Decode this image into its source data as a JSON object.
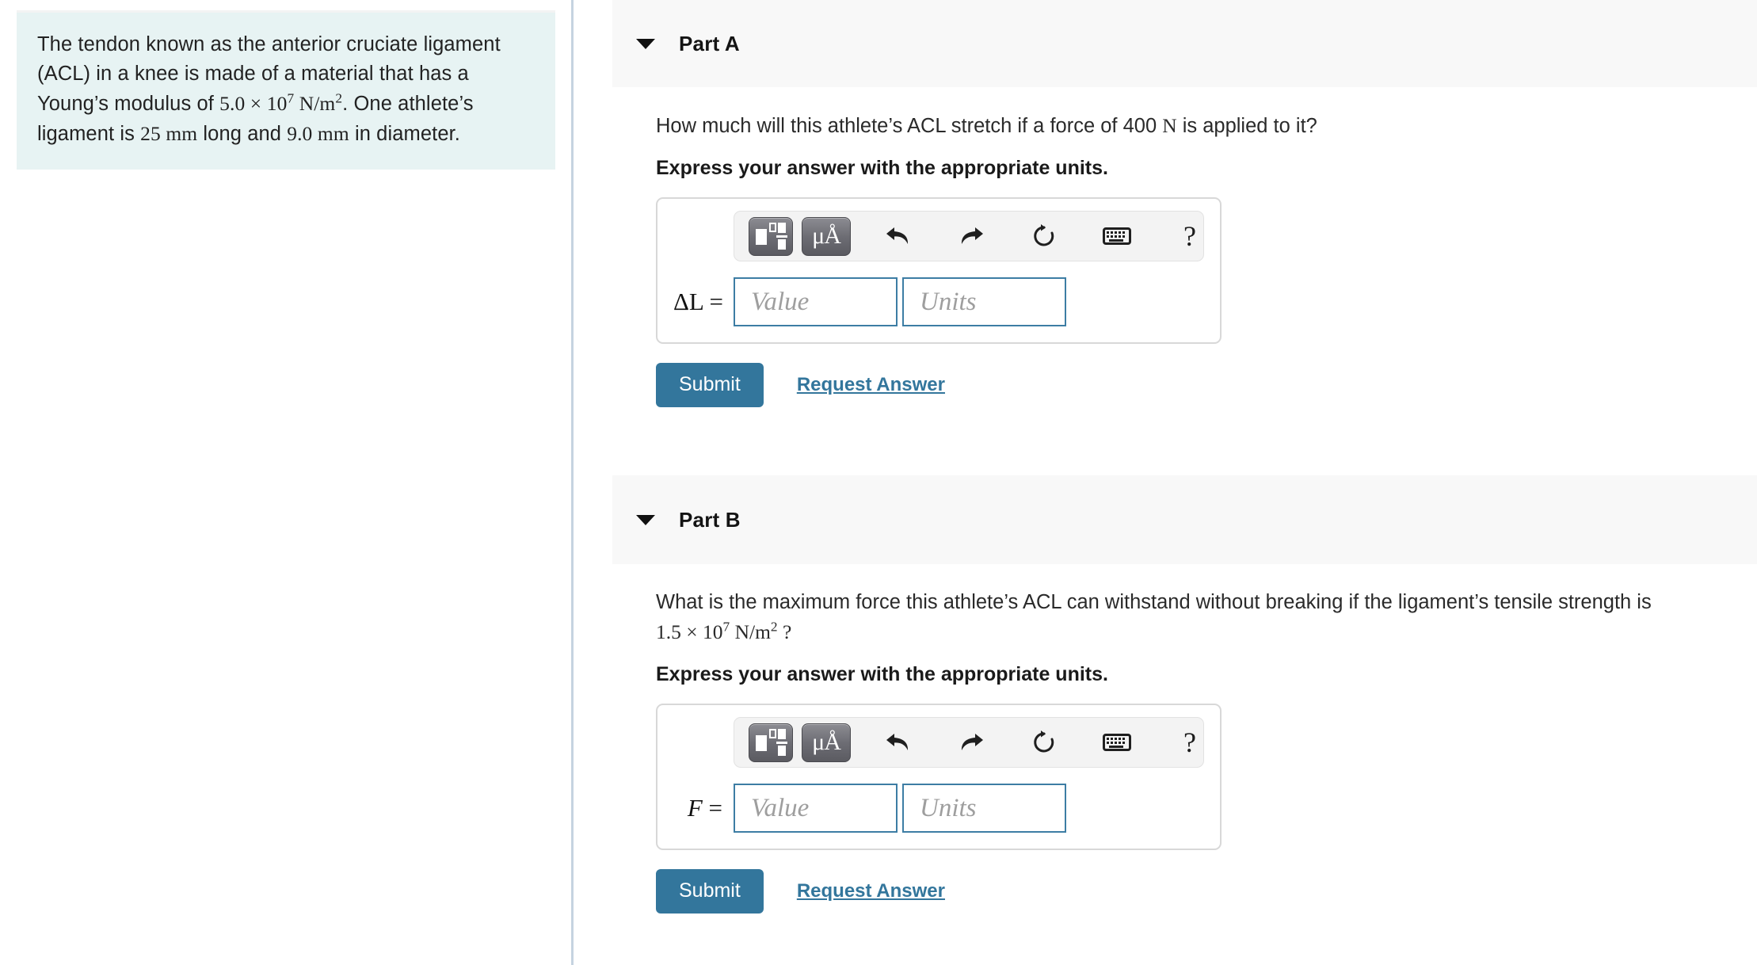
{
  "problem": {
    "text_line1": "The tendon known as the anterior cruciate ligament",
    "text_line2": "(ACL) in a knee is made of a material that has a",
    "text_line3_prefix": "Young’s modulus of ",
    "text_line3_math": "5.0 × 10",
    "text_line3_exp": "7",
    "text_line3_unit": " N/m",
    "text_line3_unit_exp": "2",
    "text_line3_suffix": ". One athlete’s",
    "text_line4_prefix": "ligament is ",
    "text_line4_math1": "25 mm",
    "text_line4_mid": " long and ",
    "text_line4_math2": "9.0 mm",
    "text_line4_suffix": " in diameter.",
    "background_color": "#e7f3f3"
  },
  "parts": [
    {
      "id": "a",
      "title": "Part A",
      "caret_icon": "triangle-down-icon",
      "question_prefix": "How much will this athlete’s ACL stretch if a force of 400 ",
      "question_math": "N",
      "question_suffix": " is applied to it?",
      "express_label": "Express your answer with the appropriate units.",
      "variable_label": "ΔL",
      "variable_equals": "=",
      "value_placeholder": "Value",
      "units_placeholder": "Units",
      "submit_label": "Submit",
      "request_label": "Request Answer",
      "toolbar": {
        "template_button": "math-template-icon",
        "units_button": "μÅ",
        "undo_icon": "undo-arrow-icon",
        "redo_icon": "redo-arrow-icon",
        "reset_icon": "reset-circle-icon",
        "keyboard_icon": "keyboard-icon",
        "help_label": "?"
      }
    },
    {
      "id": "b",
      "title": "Part B",
      "question_line1": "What is the maximum force this athlete’s ACL can withstand without breaking if the ligament’s tensile strength is",
      "question_line2_math": "1.5 × 10",
      "question_line2_exp": "7",
      "question_line2_unit": " N/m",
      "question_line2_unit_exp": "2",
      "question_line2_suffix": " ?",
      "express_label": "Express your answer with the appropriate units.",
      "variable_label": "F",
      "variable_equals": "=",
      "value_placeholder": "Value",
      "units_placeholder": "Units",
      "submit_label": "Submit",
      "request_label": "Request Answer",
      "toolbar": {
        "template_button": "math-template-icon",
        "units_button": "μÅ",
        "undo_icon": "undo-arrow-icon",
        "redo_icon": "redo-arrow-icon",
        "reset_icon": "reset-circle-icon",
        "keyboard_icon": "keyboard-icon",
        "help_label": "?"
      }
    }
  ],
  "colors": {
    "accent": "#33769c",
    "header_bg": "#f8f8f8",
    "divider": "#c5d3e0",
    "field_border": "#3d7da4"
  }
}
